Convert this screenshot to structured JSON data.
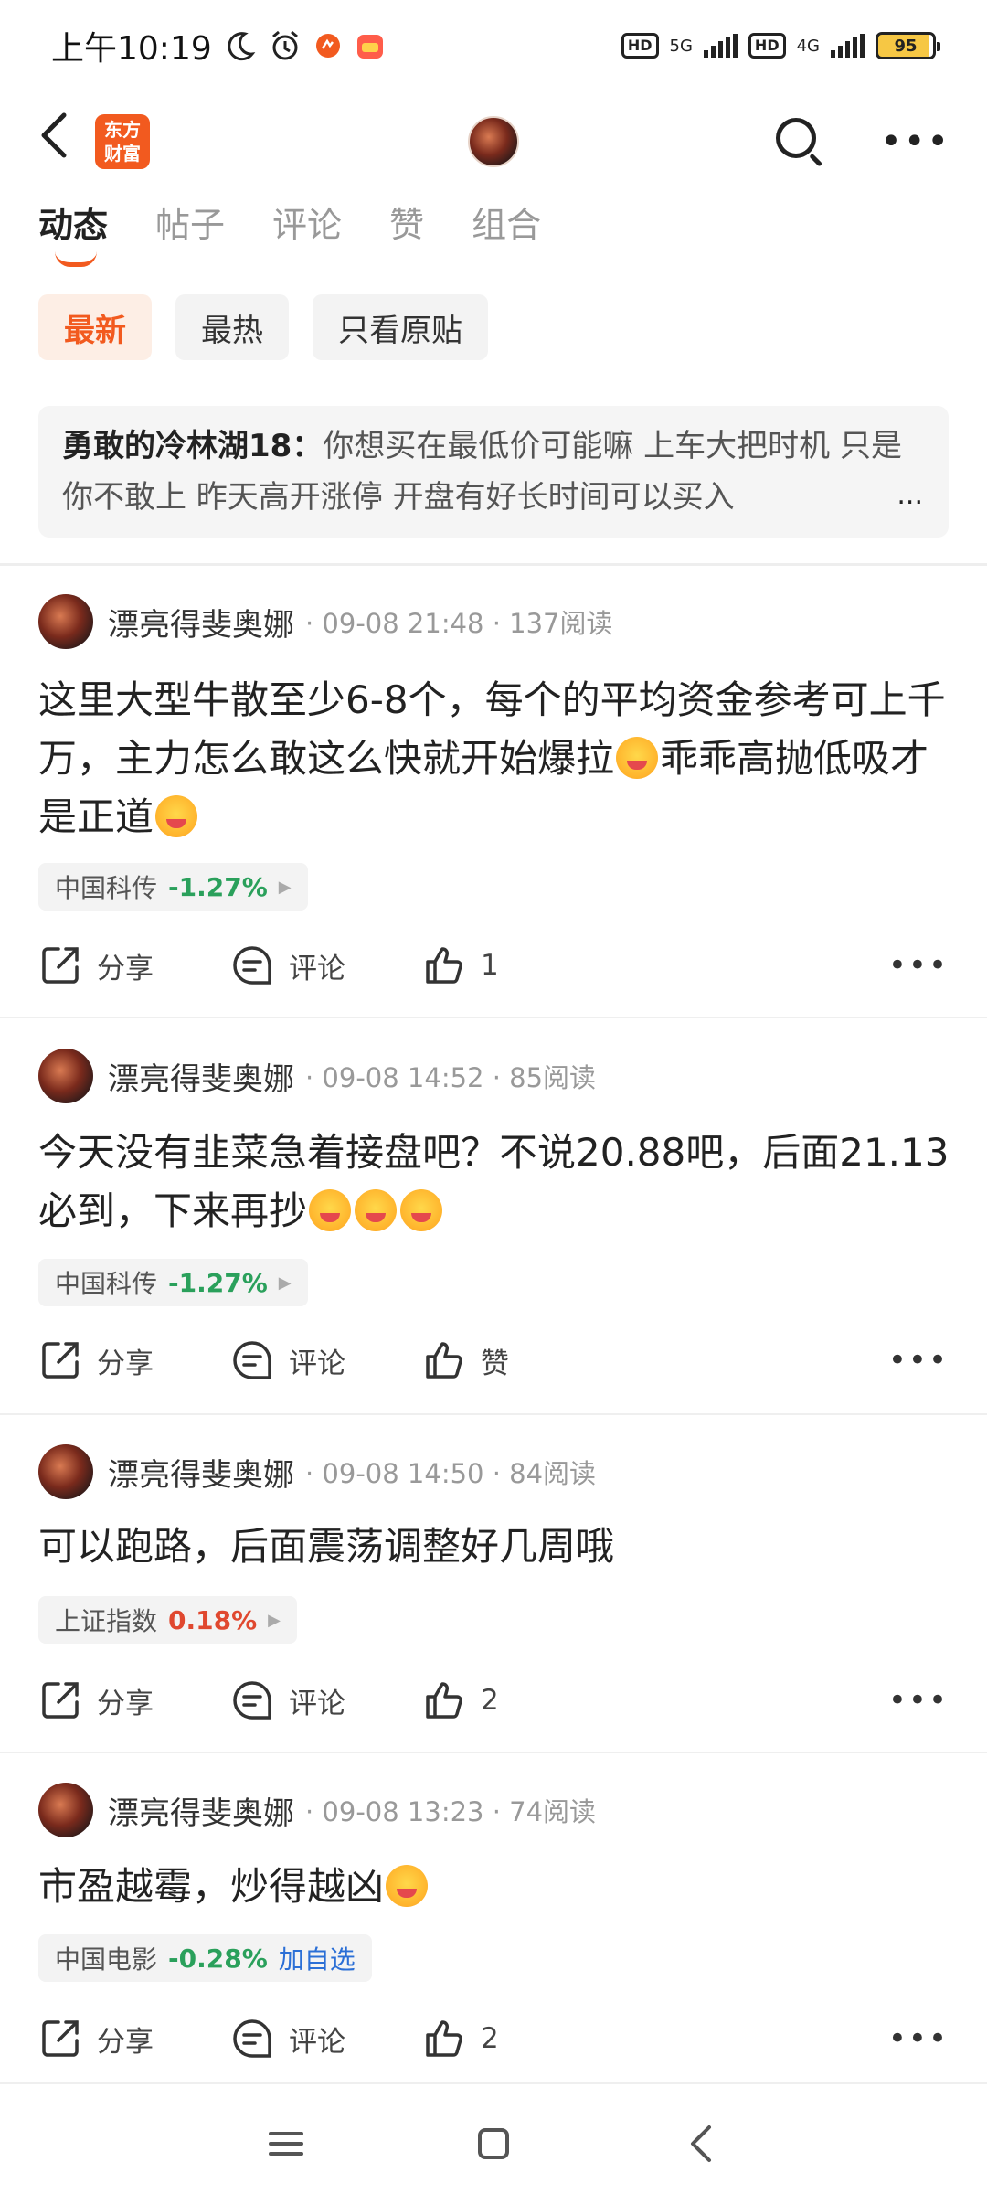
{
  "statusbar": {
    "time": "上午10:19",
    "net1": "5G",
    "net2": "4G",
    "hd": "HD",
    "battery": "95"
  },
  "navbar": {
    "logo_line1": "东方",
    "logo_line2": "财富"
  },
  "tabs": [
    "动态",
    "帖子",
    "评论",
    "赞",
    "组合"
  ],
  "filters": [
    "最新",
    "最热",
    "只看原贴"
  ],
  "pinned": {
    "user": "勇敢的冷林湖18：",
    "text": "你想买在最低价可能嘛 上车大把时机 只是你不敢上 昨天高开涨停 开盘有好长时间可以买入",
    "ellipsis": "..."
  },
  "actions": {
    "share": "分享",
    "comment": "评论",
    "like_empty": "赞"
  },
  "posts": [
    {
      "author": "漂亮得斐奥娜",
      "time": "· 09-08 21:48 · 137阅读",
      "text1": "这里大型牛散至少6-8个，每个的平均资金参考可上千万，主力怎么敢这么快就开始爆拉",
      "text2": "乖乖高抛低吸才是正道",
      "stock": "中国科传",
      "pct": "-1.27%",
      "likes": "1"
    },
    {
      "author": "漂亮得斐奥娜",
      "time": "· 09-08 14:52 · 85阅读",
      "text1": "今天没有韭菜急着接盘吧？不说20.88吧，后面21.13必到，下来再抄",
      "stock": "中国科传",
      "pct": "-1.27%",
      "likes": "赞"
    },
    {
      "author": "漂亮得斐奥娜",
      "time": "· 09-08 14:50 · 84阅读",
      "text1": "可以跑路，后面震荡调整好几周哦",
      "stock": "上证指数",
      "pct": "0.18%",
      "likes": "2"
    },
    {
      "author": "漂亮得斐奥娜",
      "time": "· 09-08 13:23 · 74阅读",
      "text1": "市盈越霉，炒得越凶",
      "stock": "中国电影",
      "pct": "-0.28%",
      "add": "加自选",
      "likes": "2"
    }
  ]
}
